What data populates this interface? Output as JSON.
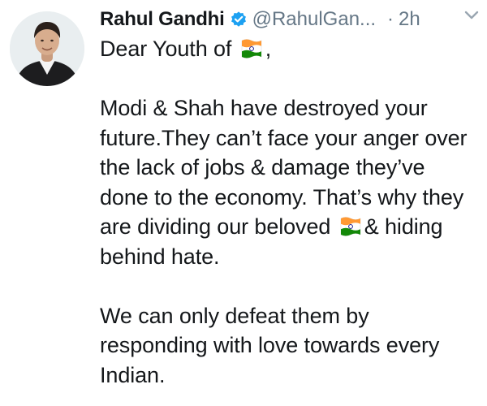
{
  "tweet": {
    "author_name": "Rahul Gandhi",
    "handle": "@RahulGan...",
    "separator": "·",
    "time": "2h",
    "greeting_text": "Dear Youth of",
    "greeting_suffix": ",",
    "para1_line1": "Modi & Shah have destroyed your",
    "para1_line2": "future.They can’t face your anger over",
    "para1_line3": "the lack of jobs & damage they’ve",
    "para1_line4": "done to the economy. That’s why they",
    "para1_line5_before": "are dividing our beloved",
    "para1_line5_after": "& hiding",
    "para1_line6": "behind hate.",
    "para2_line1": "We can only defeat them by",
    "para2_line2": "responding with love towards every",
    "para2_line3": "Indian."
  },
  "icons": {
    "verified": "verified-badge-icon",
    "caret": "chevron-down-icon",
    "flag": "india-flag-emoji"
  },
  "colors": {
    "text": "#14171a",
    "secondary": "#657786",
    "verified": "#1da1f2",
    "saffron": "#ff9933",
    "green": "#138808",
    "chakra": "#000080"
  }
}
